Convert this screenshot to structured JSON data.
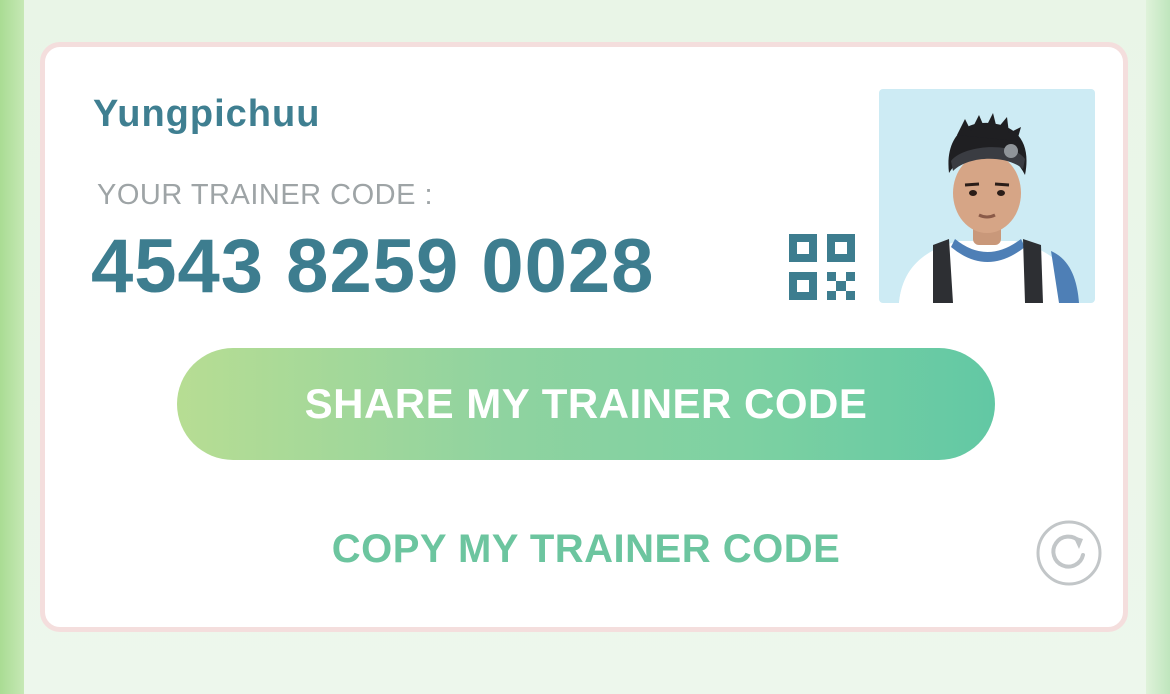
{
  "profile": {
    "trainer_name": "Yungpichuu",
    "code_label": "YOUR TRAINER CODE :",
    "trainer_code": "4543 8259 0028"
  },
  "actions": {
    "share_label": "SHARE MY TRAINER CODE",
    "copy_label": "COPY MY TRAINER CODE"
  },
  "icons": {
    "qr": "qr-code-icon",
    "refresh": "refresh-icon",
    "avatar": "trainer-avatar"
  },
  "colors": {
    "accent_teal": "#3d7d8f",
    "button_gradient_start": "#b7dd93",
    "button_gradient_end": "#62c8a4",
    "copy_text": "#6cc59f",
    "card_border": "#f4dedd"
  }
}
